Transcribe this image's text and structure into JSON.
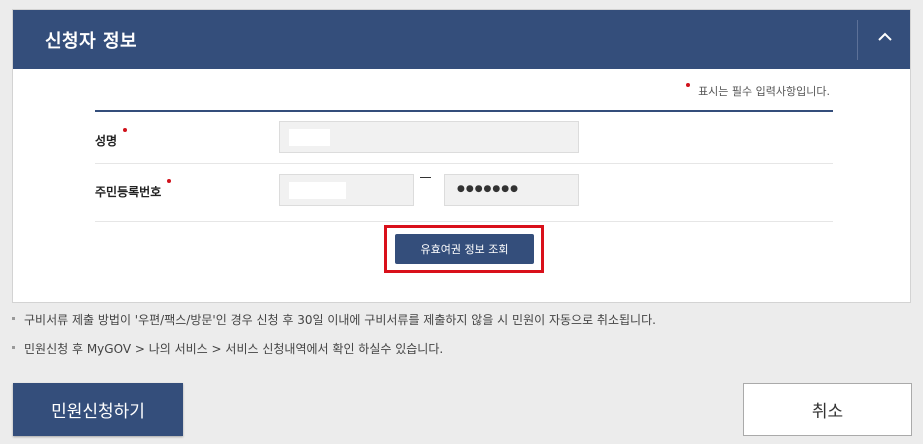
{
  "section": {
    "title": "신청자 정보",
    "collapse_icon": "chevron-up-icon"
  },
  "required_note": "표시는 필수 입력사항입니다.",
  "fields": {
    "name": {
      "label": "성명",
      "value": ""
    },
    "resident_number": {
      "label": "주민등록번호",
      "front_value": "",
      "back_value": "●●●●●●●"
    }
  },
  "lookup_button": "유효여권 정보 조회",
  "notes": [
    "구비서류 제출 방법이 '우편/팩스/방문'인 경우 신청 후 30일 이내에 구비서류를 제출하지 않을 시 민원이 자동으로 취소됩니다.",
    "민원신청 후 MyGOV > 나의 서비스 > 서비스 신청내역에서 확인 하실수 있습니다."
  ],
  "actions": {
    "apply": "민원신청하기",
    "cancel": "취소"
  },
  "colors": {
    "primary": "#344e7b",
    "required": "#d0121b",
    "highlight": "#d9101a"
  }
}
